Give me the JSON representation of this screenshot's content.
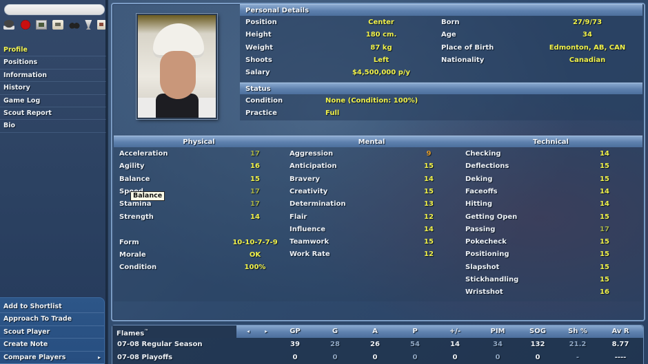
{
  "sidebar": {
    "search_placeholder": "",
    "icons": [
      "home-helmet-icon",
      "red-badge-icon",
      "rink-icon",
      "bag-icon",
      "binoculars-icon",
      "trophy-icon",
      "document-icon"
    ],
    "nav_items": [
      {
        "label": "Profile",
        "active": true
      },
      {
        "label": "Positions",
        "active": false
      },
      {
        "label": "Information",
        "active": false
      },
      {
        "label": "History",
        "active": false
      },
      {
        "label": "Game Log",
        "active": false
      },
      {
        "label": "Scout Report",
        "active": false
      },
      {
        "label": "Bio",
        "active": false
      }
    ],
    "actions": [
      {
        "label": "Add to Shortlist"
      },
      {
        "label": "Approach To Trade"
      },
      {
        "label": "Scout Player"
      },
      {
        "label": "Create Note"
      },
      {
        "label": "Compare Players",
        "arrow": "▸"
      }
    ]
  },
  "personal": {
    "title": "Personal Details",
    "left": [
      {
        "label": "Position",
        "value": "Center"
      },
      {
        "label": "Height",
        "value": "180 cm."
      },
      {
        "label": "Weight",
        "value": "87 kg"
      },
      {
        "label": "Shoots",
        "value": "Left"
      },
      {
        "label": "Salary",
        "value": "$4,500,000 p/y"
      }
    ],
    "right": [
      {
        "label": "Born",
        "value": "27/9/73"
      },
      {
        "label": "Age",
        "value": "34"
      },
      {
        "label": "Place of Birth",
        "value": "Edmonton, AB, CAN"
      },
      {
        "label": "Nationality",
        "value": "Canadian"
      }
    ]
  },
  "status": {
    "title": "Status",
    "rows": [
      {
        "label": "Condition",
        "value": "None (Condition: 100%)"
      },
      {
        "label": "Practice",
        "value": "Full"
      }
    ]
  },
  "attributes": {
    "physical": {
      "title": "Physical",
      "rows": [
        {
          "label": "Acceleration",
          "value": "17",
          "tier": "good"
        },
        {
          "label": "Agility",
          "value": "16",
          "tier": "normal"
        },
        {
          "label": "Balance",
          "value": "15",
          "tier": "normal"
        },
        {
          "label": "Speed",
          "value": "17",
          "tier": "good"
        },
        {
          "label": "Stamina",
          "value": "17",
          "tier": "good"
        },
        {
          "label": "Strength",
          "value": "14",
          "tier": "normal"
        }
      ],
      "extra": [
        {
          "label": "Form",
          "value": "10-10-7-7-9"
        },
        {
          "label": "Morale",
          "value": "OK"
        },
        {
          "label": "Condition",
          "value": "100%"
        }
      ]
    },
    "mental": {
      "title": "Mental",
      "rows": [
        {
          "label": "Aggression",
          "value": "9",
          "tier": "low"
        },
        {
          "label": "Anticipation",
          "value": "15",
          "tier": "normal"
        },
        {
          "label": "Bravery",
          "value": "14",
          "tier": "normal"
        },
        {
          "label": "Creativity",
          "value": "15",
          "tier": "normal"
        },
        {
          "label": "Determination",
          "value": "13",
          "tier": "normal"
        },
        {
          "label": "Flair",
          "value": "12",
          "tier": "normal"
        },
        {
          "label": "Influence",
          "value": "14",
          "tier": "normal"
        },
        {
          "label": "Teamwork",
          "value": "15",
          "tier": "normal"
        },
        {
          "label": "Work Rate",
          "value": "12",
          "tier": "normal"
        }
      ]
    },
    "technical": {
      "title": "Technical",
      "rows": [
        {
          "label": "Checking",
          "value": "14",
          "tier": "normal"
        },
        {
          "label": "Deflections",
          "value": "15",
          "tier": "normal"
        },
        {
          "label": "Deking",
          "value": "15",
          "tier": "normal"
        },
        {
          "label": "Faceoffs",
          "value": "14",
          "tier": "normal"
        },
        {
          "label": "Hitting",
          "value": "14",
          "tier": "normal"
        },
        {
          "label": "Getting Open",
          "value": "15",
          "tier": "normal"
        },
        {
          "label": "Passing",
          "value": "17",
          "tier": "good"
        },
        {
          "label": "Pokecheck",
          "value": "15",
          "tier": "normal"
        },
        {
          "label": "Positioning",
          "value": "15",
          "tier": "normal"
        },
        {
          "label": "Slapshot",
          "value": "15",
          "tier": "normal"
        },
        {
          "label": "Stickhandling",
          "value": "15",
          "tier": "normal"
        },
        {
          "label": "Wristshot",
          "value": "16",
          "tier": "normal"
        }
      ]
    }
  },
  "tooltip": {
    "text": "Balance"
  },
  "stats": {
    "team": "Flames",
    "team_suffix": "™",
    "prev_arrow": "◂",
    "next_arrow": "▸",
    "columns": [
      "GP",
      "G",
      "A",
      "P",
      "+/-",
      "PIM",
      "SOG",
      "Sh %",
      "Av R"
    ],
    "dim_columns": [
      1,
      3,
      5,
      7
    ],
    "rows": [
      {
        "name": "07-08 Regular Season",
        "values": [
          "39",
          "28",
          "26",
          "54",
          "14",
          "34",
          "132",
          "21.2",
          "8.77"
        ]
      },
      {
        "name": "07-08 Playoffs",
        "values": [
          "0",
          "0",
          "0",
          "0",
          "0",
          "0",
          "0",
          "-",
          "----"
        ]
      }
    ]
  },
  "colors": {
    "value_yellow": "#f2f24a",
    "value_good": "#a8b24a",
    "value_low": "#e09a2a",
    "header_blue": "#5d80ad",
    "active_nav": "#f4f452"
  }
}
